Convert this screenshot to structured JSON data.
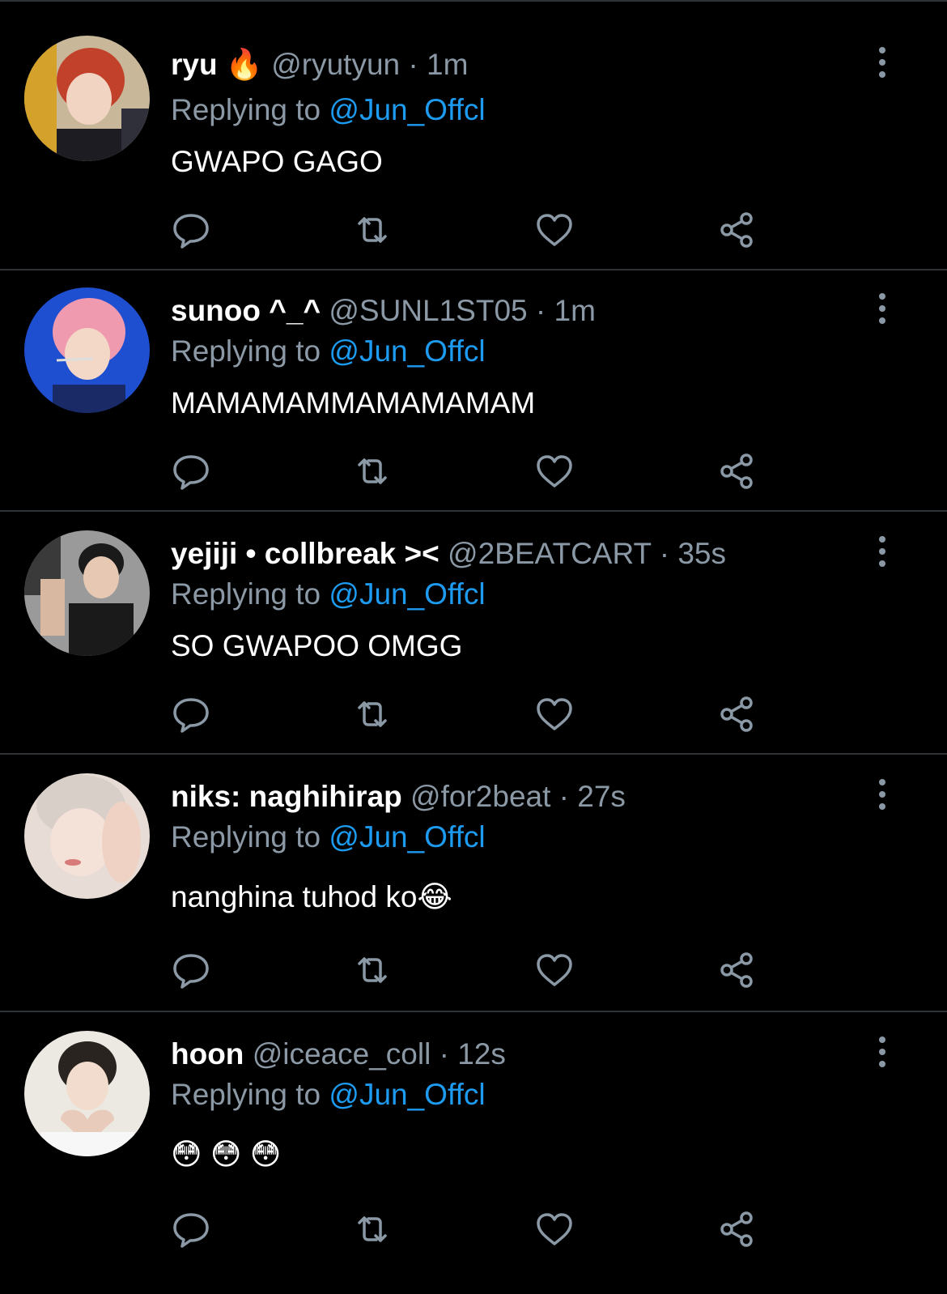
{
  "colors": {
    "background": "#000000",
    "divider": "#2f3336",
    "name": "#ffffff",
    "meta": "#8b98a5",
    "mention": "#1d9bf0",
    "icon": "#8b98a5"
  },
  "action_icons": [
    "reply-icon",
    "retweet-icon",
    "like-icon",
    "share-icon"
  ],
  "tweets": [
    {
      "name": "ryu 🔥",
      "handle": "@ryutyun",
      "time": "1m",
      "replying_label": "Replying to",
      "replying_to": "@Jun_Offcl",
      "text": "GWAPO GAGO",
      "avatar_icon": "avatar-image"
    },
    {
      "name": "sunoo ^_^",
      "handle": "@SUNL1ST05",
      "time": "1m",
      "replying_label": "Replying to",
      "replying_to": "@Jun_Offcl",
      "text": "MAMAMAMMAMAMAMAM",
      "avatar_icon": "avatar-image"
    },
    {
      "name": "yejiji • collbreak ><",
      "handle": "@2BEATCART",
      "time": "35s",
      "replying_label": "Replying to",
      "replying_to": "@Jun_Offcl",
      "text": "SO GWAPOO OMGG",
      "avatar_icon": "avatar-image"
    },
    {
      "name": "niks: naghihirap",
      "handle": "@for2beat",
      "time": "27s",
      "replying_label": "Replying to",
      "replying_to": "@Jun_Offcl",
      "text": "nanghina tuhod ko😂",
      "avatar_icon": "avatar-image"
    },
    {
      "name": "hoon",
      "handle": "@iceace_coll",
      "time": "12s",
      "replying_label": "Replying to",
      "replying_to": "@Jun_Offcl",
      "text": "😳 😳 😳",
      "avatar_icon": "avatar-image"
    }
  ]
}
